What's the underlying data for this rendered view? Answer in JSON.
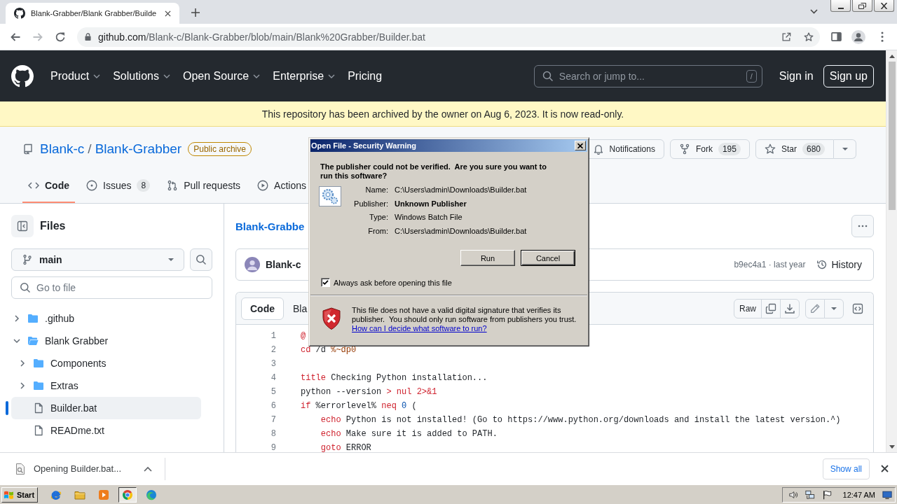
{
  "browser": {
    "tabs": [
      {
        "title": "Blank-Grabber/Blank Grabber/Builde",
        "selected": true
      }
    ],
    "forward_disabled": true,
    "address": {
      "domain": "github.com",
      "path": "/Blank-c/Blank-Grabber/blob/main/Blank%20Grabber/Builder.bat"
    }
  },
  "site_header": {
    "nav": [
      {
        "label": "Product",
        "dropdown": true
      },
      {
        "label": "Solutions",
        "dropdown": true
      },
      {
        "label": "Open Source",
        "dropdown": true
      },
      {
        "label": "Enterprise",
        "dropdown": true
      },
      {
        "label": "Pricing",
        "dropdown": false
      }
    ],
    "search": {
      "placeholder": "Search or jump to...",
      "shortcut": "/"
    },
    "sign_in": "Sign in",
    "sign_up": "Sign up"
  },
  "archive_banner": "This repository has been archived by the owner on Aug 6, 2023. It is now read-only.",
  "repo": {
    "owner": "Blank-c",
    "separator": "/",
    "name": "Blank-Grabber",
    "badge": "Public archive",
    "actions": [
      {
        "kind": "notifications",
        "label": "Notifications",
        "dropdown": false
      },
      {
        "kind": "fork",
        "label": "Fork",
        "count": "195",
        "dropdown": false
      },
      {
        "kind": "star",
        "label": "Star",
        "count": "680",
        "dropdown": true
      }
    ],
    "tabs": [
      {
        "kind": "code",
        "label": "Code",
        "selected": true
      },
      {
        "kind": "issues",
        "label": "Issues",
        "count": "8",
        "selected": false
      },
      {
        "kind": "pulls",
        "label": "Pull requests",
        "selected": false
      },
      {
        "kind": "actions",
        "label": "Actions",
        "selected": false
      }
    ]
  },
  "sidebar": {
    "title": "Files",
    "branch": "main",
    "search": {
      "placeholder": "Go to file"
    },
    "tree": [
      {
        "name": ".github",
        "kind": "folder",
        "expanded": false,
        "selected": false
      },
      {
        "name": "Blank Grabber",
        "kind": "folder",
        "expanded": true,
        "selected": false,
        "children": [
          {
            "name": "Components",
            "kind": "folder",
            "expanded": false,
            "selected": false
          },
          {
            "name": "Extras",
            "kind": "folder",
            "expanded": false,
            "selected": false
          },
          {
            "name": "Builder.bat",
            "kind": "file",
            "selected": true
          },
          {
            "name": "READme.txt",
            "kind": "file",
            "selected": false
          }
        ]
      }
    ]
  },
  "file_view": {
    "breadcrumb": "Blank-Grabbe",
    "commit": {
      "author": "Blank-c",
      "meta": "b9ec4a1 · last year",
      "history": "History"
    },
    "view_tabs": [
      {
        "label": "Code",
        "selected": true
      },
      {
        "label": "Bla",
        "selected": false
      }
    ],
    "raw": "Raw",
    "lines": [
      {
        "number": "1",
        "tokens": [
          {
            "text": "@",
            "kind": "keyword"
          }
        ]
      },
      {
        "number": "2",
        "tokens": [
          {
            "text": "cd",
            "kind": "keyword"
          },
          {
            "text": " /d ",
            "kind": "plain"
          },
          {
            "text": "%~dp0",
            "kind": "variable"
          }
        ]
      },
      {
        "number": "3"
      },
      {
        "number": "4",
        "tokens": [
          {
            "text": "title",
            "kind": "keyword"
          },
          {
            "text": " Checking Python installation...",
            "kind": "plain"
          }
        ]
      },
      {
        "number": "5",
        "tokens": [
          {
            "text": "python --version ",
            "kind": "plain"
          },
          {
            "text": "> nul 2>&1",
            "kind": "keyword"
          }
        ]
      },
      {
        "number": "6",
        "tokens": [
          {
            "text": "if",
            "kind": "keyword"
          },
          {
            "text": " %errorlevel% ",
            "kind": "plain"
          },
          {
            "text": "neq",
            "kind": "keyword"
          },
          {
            "text": " 0",
            "kind": "constant"
          },
          {
            "text": " (",
            "kind": "plain"
          }
        ]
      },
      {
        "number": "7",
        "tokens": [
          {
            "text": "    echo",
            "kind": "keyword"
          },
          {
            "text": " Python is not installed! (Go to https://www.python.org/downloads and install the latest version.^)",
            "kind": "plain"
          }
        ]
      },
      {
        "number": "8",
        "tokens": [
          {
            "text": "    echo",
            "kind": "keyword"
          },
          {
            "text": " Make sure it is added to PATH.",
            "kind": "plain"
          }
        ]
      },
      {
        "number": "9",
        "tokens": [
          {
            "text": "    goto",
            "kind": "keyword"
          },
          {
            "text": " ERROR",
            "kind": "plain"
          }
        ]
      }
    ]
  },
  "dialog": {
    "title": "Open File - Security Warning",
    "question": "The publisher could not be verified.  Are you sure you want to run this software?",
    "fields": [
      {
        "label": "Name:",
        "value": "C:\\Users\\admin\\Downloads\\Builder.bat",
        "bold": false
      },
      {
        "label": "Publisher:",
        "value": "Unknown Publisher",
        "bold": true
      },
      {
        "label": "Type:",
        "value": "Windows Batch File",
        "bold": false
      },
      {
        "label": "From:",
        "value": "C:\\Users\\admin\\Downloads\\Builder.bat",
        "bold": false
      }
    ],
    "buttons": [
      {
        "label": "Run",
        "default": false
      },
      {
        "label": "Cancel",
        "default": true
      }
    ],
    "checkbox": {
      "label": "Always ask before opening this file",
      "checked": true
    },
    "warning": "This file does not have a valid digital signature that verifies its publisher.  You should only run software from publishers you trust.",
    "help_link": "How can I decide what software to run?"
  },
  "download_bar": {
    "downloads": [
      {
        "label": "Opening Builder.bat..."
      }
    ],
    "show_all": "Show all"
  },
  "taskbar": {
    "start": "Start",
    "apps": [
      {
        "active": false
      },
      {
        "active": false
      },
      {
        "active": false
      },
      {
        "active": true
      },
      {
        "active": false
      }
    ],
    "clock": "12:47 AM"
  }
}
